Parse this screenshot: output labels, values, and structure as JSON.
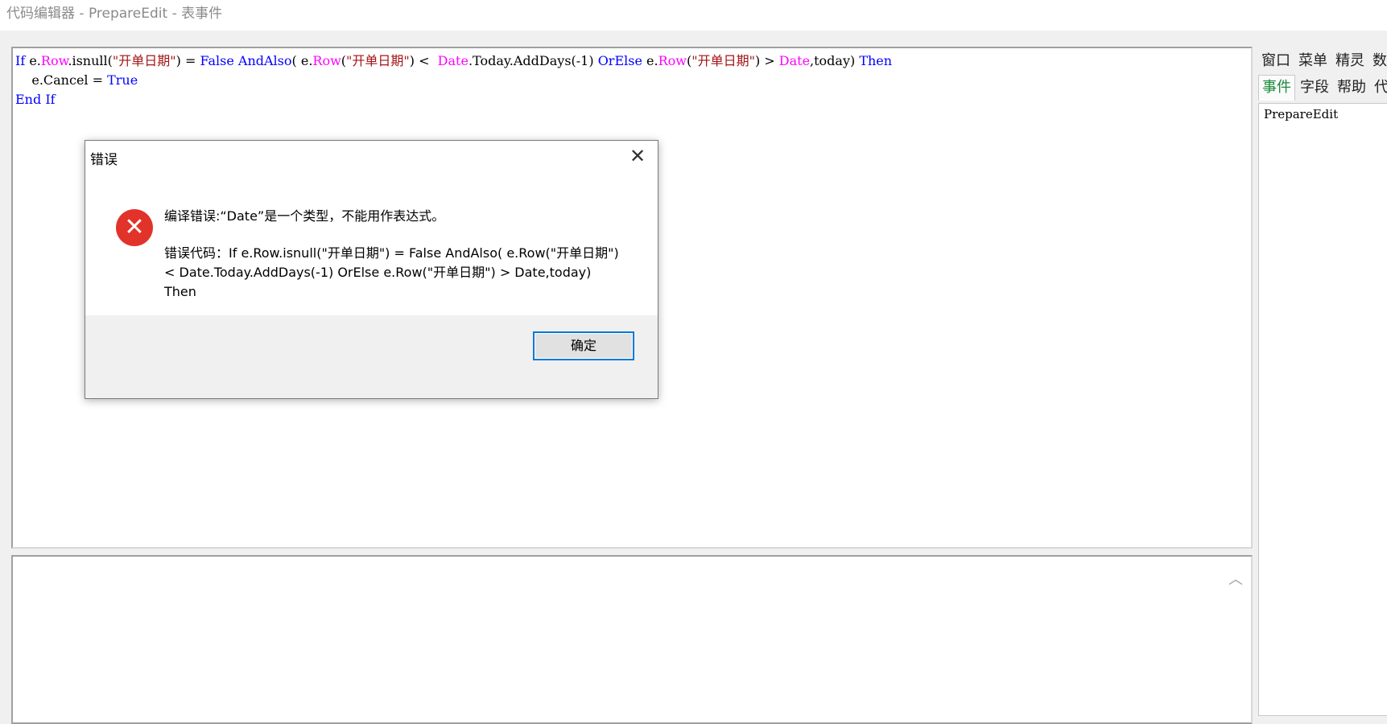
{
  "window": {
    "title": "代码编辑器 - PrepareEdit - 表事件"
  },
  "editor": {
    "line1": {
      "p1": "If",
      "p2": " e.",
      "p3": "Row",
      "p4": ".isnull(",
      "p5": "\"开单日期\"",
      "p6": ") = ",
      "p7": "False",
      "p8": " ",
      "p9": "AndAlso",
      "p10": "( e.",
      "p11": "Row",
      "p12": "(",
      "p13": "\"开单日期\"",
      "p14": ") <  ",
      "p15": "Date",
      "p16": ".Today.AddDays(-1) ",
      "p17": "OrElse",
      "p18": " e.",
      "p19": "Row",
      "p20": "(",
      "p21": "\"开单日期\"",
      "p22": ") > ",
      "p23": "Date",
      "p24": ",today) ",
      "p25": "Then"
    },
    "line2": {
      "p1": "    e.Cancel = ",
      "p2": "True"
    },
    "line3": {
      "p1": "End If"
    }
  },
  "side_panel": {
    "tabs_row1": [
      "窗口",
      "菜单",
      "精灵",
      "数"
    ],
    "tabs_row2": [
      "事件",
      "字段",
      "帮助",
      "代"
    ],
    "list_item": "PrepareEdit"
  },
  "dialog": {
    "title": "错误",
    "close_symbol": "✕",
    "icon_symbol": "✕",
    "message": "编译错误:“Date”是一个类型，不能用作表达式。",
    "code_message": "错误代码：If e.Row.isnull(\"开单日期\") = False AndAlso( e.Row(\"开单日期\") <  Date.Today.AddDays(-1) OrElse e.Row(\"开单日期\") > Date,today) Then",
    "ok_label": "确定"
  },
  "output": {
    "scroll_up_symbol": "︿"
  }
}
